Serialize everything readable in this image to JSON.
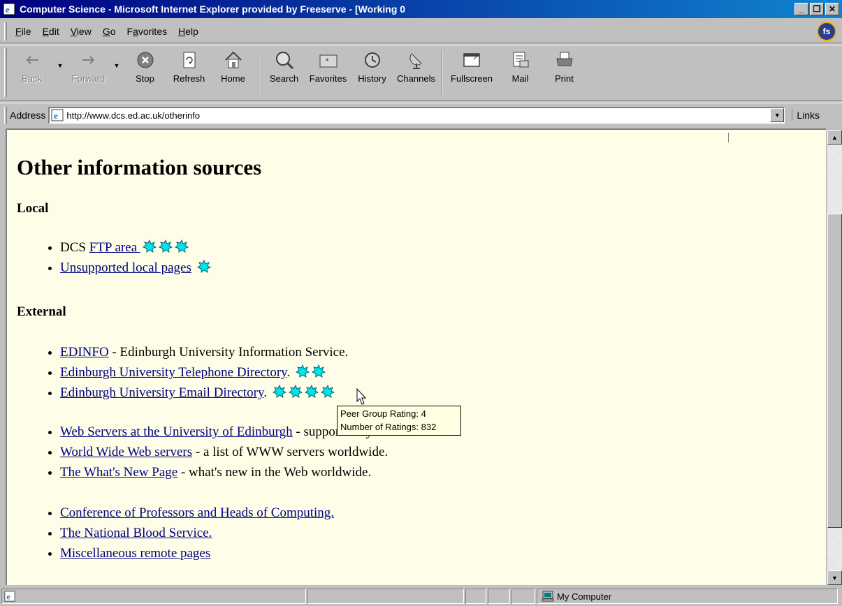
{
  "window": {
    "title": "Computer Science - Microsoft Internet Explorer provided by Freeserve - [Working 0",
    "minimize": "_",
    "maximize": "❐",
    "close": "✕"
  },
  "menu": {
    "items": [
      "File",
      "Edit",
      "View",
      "Go",
      "Favorites",
      "Help"
    ],
    "logo": "fs"
  },
  "toolbar": {
    "back": "Back",
    "forward": "Forward",
    "stop": "Stop",
    "refresh": "Refresh",
    "home": "Home",
    "search": "Search",
    "favorites": "Favorites",
    "history": "History",
    "channels": "Channels",
    "fullscreen": "Fullscreen",
    "mail": "Mail",
    "print": "Print"
  },
  "address": {
    "label": "Address",
    "url": "http://www.dcs.ed.ac.uk/otherinfo",
    "links": "Links"
  },
  "page": {
    "heading": "Other information sources",
    "local_heading": "Local",
    "local_items": [
      {
        "prefix": "DCS ",
        "link": "FTP area ",
        "suffix": "",
        "ratings": 3
      },
      {
        "prefix": "",
        "link": "Unsupported local pages",
        "suffix": " ",
        "ratings": 1
      }
    ],
    "external_heading": "External",
    "external_group1": [
      {
        "link": "EDINFO",
        "suffix": " - Edinburgh University Information Service.",
        "ratings": 0
      },
      {
        "link": "Edinburgh University Telephone Directory",
        "suffix": ". ",
        "ratings": 2
      },
      {
        "link": "Edinburgh University Email Directory",
        "suffix": ". ",
        "ratings": 4
      }
    ],
    "external_group2": [
      {
        "link": "Web Servers at the University of Edinburgh",
        "suffix": " - supported by EUCS.",
        "ratings": 0
      },
      {
        "link": "World Wide Web servers",
        "suffix": " - a list of WWW servers worldwide.",
        "ratings": 0
      },
      {
        "link": "The What's New Page",
        "suffix": " - what's new in the Web worldwide.",
        "ratings": 0
      }
    ],
    "external_group3": [
      {
        "link": "Conference of Professors and Heads of Computing.",
        "suffix": "",
        "ratings": 0
      },
      {
        "link": "The National Blood Service.",
        "suffix": "",
        "ratings": 0
      },
      {
        "link": "Miscellaneous remote pages",
        "suffix": "",
        "ratings": 0
      }
    ]
  },
  "tooltip": {
    "line1": "Peer Group Rating: 4",
    "line2": "Number of Ratings: 832"
  },
  "status": {
    "zone": "My Computer"
  },
  "colors": {
    "link": "#000080",
    "rating_icon": "#00e5e5",
    "page_bg": "#fefee8"
  }
}
